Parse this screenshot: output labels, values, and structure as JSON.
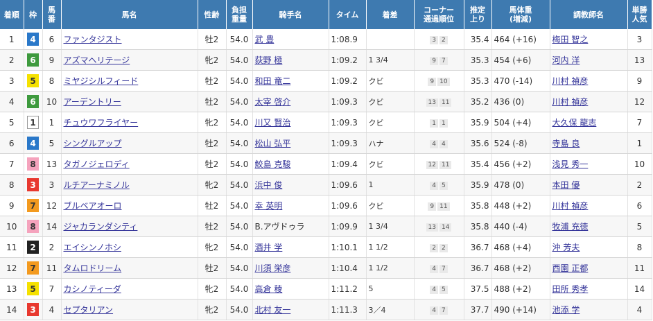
{
  "headers": [
    "着順",
    "枠",
    "馬番",
    "馬名",
    "性齢",
    "負担重量",
    "騎手名",
    "タイム",
    "着差",
    "コーナー通過順位",
    "推定上り",
    "馬体重(増減)",
    "調教師名",
    "単勝人気"
  ],
  "header_lines": [
    [
      "着順"
    ],
    [
      "枠"
    ],
    [
      "馬",
      "番"
    ],
    [
      "馬名"
    ],
    [
      "性齢"
    ],
    [
      "負担",
      "重量"
    ],
    [
      "騎手名"
    ],
    [
      "タイム"
    ],
    [
      "着差"
    ],
    [
      "コーナー",
      "通過順位"
    ],
    [
      "推定",
      "上り"
    ],
    [
      "馬体重",
      "(増減)"
    ],
    [
      "調教師名"
    ],
    [
      "単勝",
      "人気"
    ]
  ],
  "waku_colors": {
    "1": {
      "bg": "#ffffff",
      "fg": "#333333",
      "border": "#999999"
    },
    "2": {
      "bg": "#222222",
      "fg": "#ffffff",
      "border": "#222222"
    },
    "3": {
      "bg": "#e8382f",
      "fg": "#ffffff",
      "border": "#e8382f"
    },
    "4": {
      "bg": "#2a78c9",
      "fg": "#ffffff",
      "border": "#2a78c9"
    },
    "5": {
      "bg": "#f5e100",
      "fg": "#333333",
      "border": "#f5e100"
    },
    "6": {
      "bg": "#3e9a3e",
      "fg": "#ffffff",
      "border": "#3e9a3e"
    },
    "7": {
      "bg": "#f39a1f",
      "fg": "#333333",
      "border": "#f39a1f"
    },
    "8": {
      "bg": "#f5a3bd",
      "fg": "#333333",
      "border": "#f5a3bd"
    }
  },
  "rows": [
    {
      "rank": "1",
      "waku": "4",
      "num": "6",
      "horse": "ファンタジスト",
      "sexage": "牡2",
      "weight": "54.0",
      "jockey": "武 豊",
      "time": "1:08.9",
      "margin": "",
      "corners": [
        "3",
        "2"
      ],
      "last3f": "35.4",
      "body": "464 (+16)",
      "trainer": "梅田 智之",
      "pop": "3"
    },
    {
      "rank": "2",
      "waku": "6",
      "num": "9",
      "horse": "アズマヘリテージ",
      "sexage": "牝2",
      "weight": "54.0",
      "jockey": "荻野 極",
      "time": "1:09.2",
      "margin": "1 3/4",
      "corners": [
        "9",
        "7"
      ],
      "last3f": "35.3",
      "body": "454 (+6)",
      "trainer": "河内 洋",
      "pop": "13"
    },
    {
      "rank": "3",
      "waku": "5",
      "num": "8",
      "horse": "ミヤジシルフィード",
      "sexage": "牡2",
      "weight": "54.0",
      "jockey": "和田 竜二",
      "time": "1:09.2",
      "margin": "クビ",
      "corners": [
        "9",
        "10"
      ],
      "last3f": "35.3",
      "body": "470 (-14)",
      "trainer": "川村 禎彦",
      "pop": "9"
    },
    {
      "rank": "4",
      "waku": "6",
      "num": "10",
      "horse": "アーデントリー",
      "sexage": "牡2",
      "weight": "54.0",
      "jockey": "太宰 啓介",
      "time": "1:09.3",
      "margin": "クビ",
      "corners": [
        "13",
        "11"
      ],
      "last3f": "35.2",
      "body": "436 (0)",
      "trainer": "川村 禎彦",
      "pop": "12"
    },
    {
      "rank": "5",
      "waku": "1",
      "num": "1",
      "horse": "チュウワフライヤー",
      "sexage": "牝2",
      "weight": "54.0",
      "jockey": "川又 賢治",
      "time": "1:09.3",
      "margin": "クビ",
      "corners": [
        "1",
        "1"
      ],
      "last3f": "35.9",
      "body": "504 (+4)",
      "trainer": "大久保 龍志",
      "pop": "7"
    },
    {
      "rank": "6",
      "waku": "4",
      "num": "5",
      "horse": "シングルアップ",
      "sexage": "牡2",
      "weight": "54.0",
      "jockey": "松山 弘平",
      "time": "1:09.3",
      "margin": "ハナ",
      "corners": [
        "4",
        "4"
      ],
      "last3f": "35.6",
      "body": "524 (-8)",
      "trainer": "寺島 良",
      "pop": "1"
    },
    {
      "rank": "7",
      "waku": "8",
      "num": "13",
      "horse": "タガノジェロディ",
      "sexage": "牡2",
      "weight": "54.0",
      "jockey": "鮫島 克駿",
      "time": "1:09.4",
      "margin": "クビ",
      "corners": [
        "12",
        "11"
      ],
      "last3f": "35.4",
      "body": "456 (+2)",
      "trainer": "浅見 秀一",
      "pop": "10"
    },
    {
      "rank": "8",
      "waku": "3",
      "num": "3",
      "horse": "ルチアーナミノル",
      "sexage": "牝2",
      "weight": "54.0",
      "jockey": "浜中 俊",
      "time": "1:09.6",
      "margin": "1",
      "corners": [
        "4",
        "5"
      ],
      "last3f": "35.9",
      "body": "478 (0)",
      "trainer": "本田 優",
      "pop": "2"
    },
    {
      "rank": "9",
      "waku": "7",
      "num": "12",
      "horse": "ブルベアオーロ",
      "sexage": "牡2",
      "weight": "54.0",
      "jockey": "幸 英明",
      "time": "1:09.6",
      "margin": "クビ",
      "corners": [
        "9",
        "11"
      ],
      "last3f": "35.8",
      "body": "448 (+2)",
      "trainer": "川村 禎彦",
      "pop": "6"
    },
    {
      "rank": "10",
      "waku": "8",
      "num": "14",
      "horse": "ジャカランダシティ",
      "sexage": "牡2",
      "weight": "54.0",
      "jockey": "B.アヴドゥラ",
      "time": "1:09.9",
      "margin": "1 3/4",
      "corners": [
        "13",
        "14"
      ],
      "last3f": "35.8",
      "body": "440 (-4)",
      "trainer": "牧浦 充徳",
      "pop": "5"
    },
    {
      "rank": "11",
      "waku": "2",
      "num": "2",
      "horse": "エイシンノホシ",
      "sexage": "牝2",
      "weight": "54.0",
      "jockey": "酒井 学",
      "time": "1:10.1",
      "margin": "1 1/2",
      "corners": [
        "2",
        "2"
      ],
      "last3f": "36.7",
      "body": "468 (+4)",
      "trainer": "沖 芳夫",
      "pop": "8"
    },
    {
      "rank": "12",
      "waku": "7",
      "num": "11",
      "horse": "タムロドリーム",
      "sexage": "牡2",
      "weight": "54.0",
      "jockey": "川須 栄彦",
      "time": "1:10.4",
      "margin": "1 1/2",
      "corners": [
        "4",
        "7"
      ],
      "last3f": "36.7",
      "body": "468 (+2)",
      "trainer": "西園 正都",
      "pop": "11"
    },
    {
      "rank": "13",
      "waku": "5",
      "num": "7",
      "horse": "カシノティーダ",
      "sexage": "牝2",
      "weight": "54.0",
      "jockey": "高倉 稜",
      "time": "1:11.2",
      "margin": "5",
      "corners": [
        "4",
        "5"
      ],
      "last3f": "37.5",
      "body": "488 (+2)",
      "trainer": "田所 秀孝",
      "pop": "14"
    },
    {
      "rank": "14",
      "waku": "3",
      "num": "4",
      "horse": "セプタリアン",
      "sexage": "牝2",
      "weight": "54.0",
      "jockey": "北村 友一",
      "time": "1:11.3",
      "margin": "3／4",
      "corners": [
        "4",
        "7"
      ],
      "last3f": "37.7",
      "body": "490 (+14)",
      "trainer": "池添 学",
      "pop": "4"
    }
  ]
}
